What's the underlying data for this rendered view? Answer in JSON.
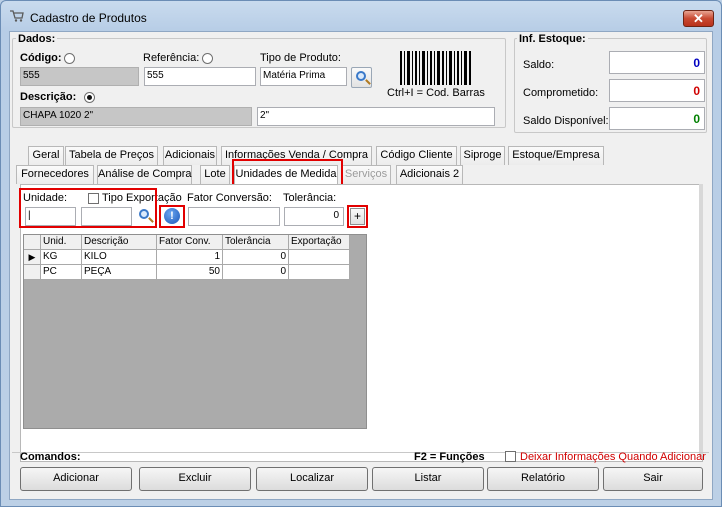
{
  "window": {
    "title": "Cadastro de Produtos",
    "close_label": "✕"
  },
  "dados": {
    "group_title": "Dados:",
    "codigo_label": "Código:",
    "codigo_value": "555",
    "referencia_label": "Referência:",
    "referencia_value": "555",
    "tipo_label": "Tipo de Produto:",
    "tipo_value": "Matéria Prima",
    "barcode_hint": "Ctrl+I = Cod. Barras",
    "descricao_label": "Descrição:",
    "descricao_value": "CHAPA 1020 2\"",
    "descricao_extra": "2\""
  },
  "estoque": {
    "group_title": "Inf. Estoque:",
    "saldo_label": "Saldo:",
    "saldo_value": "0",
    "saldo_color": "#0000c0",
    "comprometido_label": "Comprometido:",
    "comprometido_value": "0",
    "comprometido_color": "#d00000",
    "disponivel_label": "Saldo Disponível:",
    "disponivel_value": "0",
    "disponivel_color": "#008000"
  },
  "tabs_row1": [
    "Geral",
    "Tabela de Preços",
    "Adicionais",
    "Informações Venda / Compra",
    "Código Cliente",
    "Siproge",
    "Estoque/Empresa"
  ],
  "tabs_row2": [
    "Fornecedores",
    "Análise de Compra",
    "Lote",
    "Unidades de Medida",
    "Serviços",
    "Adicionais 2"
  ],
  "unidades": {
    "unidade_label": "Unidade:",
    "tipo_export_label": "Tipo Exportação",
    "fator_label": "Fator Conversão:",
    "tolerancia_label": "Tolerância:",
    "tolerancia_value": "0",
    "add_label": "+",
    "columns": [
      "Unid.",
      "Descrição",
      "Fator Conv.",
      "Tolerância",
      "Exportação"
    ],
    "rows": [
      {
        "unid": "KG",
        "descricao": "KILO",
        "fator": "1",
        "tolerancia": "0",
        "exportacao": ""
      },
      {
        "unid": "PC",
        "descricao": "PEÇA",
        "fator": "50",
        "tolerancia": "0",
        "exportacao": ""
      }
    ]
  },
  "comandos": {
    "title": "Comandos:",
    "f2_hint": "F2 = Funções",
    "deixar_label": "Deixar Informações Quando Adicionar",
    "deixar_color": "#d00000",
    "buttons": [
      "Adicionar",
      "Excluir",
      "Localizar",
      "Listar",
      "Relatório",
      "Sair"
    ]
  },
  "highlight_color": "#e20000"
}
